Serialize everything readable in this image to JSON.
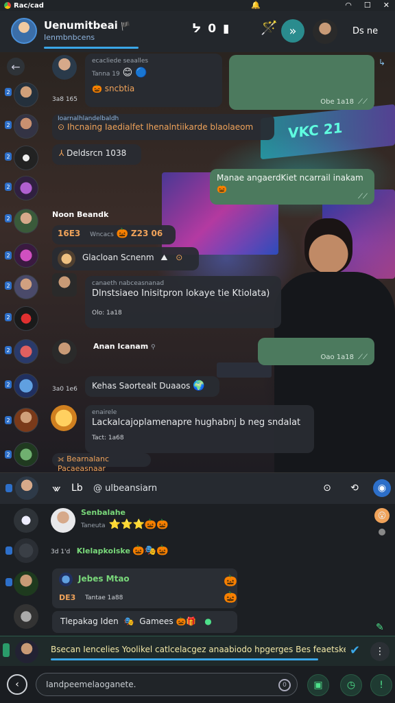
{
  "statusbar": {
    "app_name": "Rac/cad",
    "center_icon": "🔔",
    "wifi": "wifi-icon",
    "window": "☐",
    "close": "✕"
  },
  "header": {
    "title": "Uenumitbeai",
    "flag": "🏴",
    "subtitle": "Ienmbnbcens",
    "icons": [
      "ᔭ",
      "0",
      "▮"
    ],
    "done_label": "Ds ne"
  },
  "chat": {
    "neon_text": "VKC 21",
    "rail": {
      "badges": [
        "2",
        "2",
        "2",
        "2",
        "2",
        "2",
        "2",
        "2",
        "2",
        "2",
        "2",
        "2"
      ]
    },
    "messages": [
      {
        "id": "m1",
        "tiny": "ecacliede seaalles",
        "time_line": "Tanna 19",
        "sub": "sncbtia",
        "emojis": [
          "😊",
          "🔵"
        ]
      },
      {
        "id": "m2",
        "text": "",
        "meta": "Obe 1a18"
      },
      {
        "id": "rail_time_1",
        "text": "3a8 165"
      },
      {
        "id": "m3",
        "name": "Ioarnalhlandelbaldh",
        "text": "Ihcnaing Iaedialfet Ihenalntiikarde blaolaeom"
      },
      {
        "id": "m4",
        "text": "Deldsrcn 1038"
      },
      {
        "id": "m5",
        "text": "Manae angaerdKiet ncarrail inakam",
        "meta": ""
      },
      {
        "id": "m6",
        "name": "Noon Beandk",
        "tag": "16E3",
        "text": "Wncacs",
        "tag2": "Z23 06"
      },
      {
        "id": "m7",
        "text": "Glacloan Scnenm"
      },
      {
        "id": "m8",
        "tiny": "canaeth nabceasnanad",
        "text": "Dlnstsiaeo Inisitpron lokaye tie Ktiolata)",
        "sub": "Olo: 1a18"
      },
      {
        "id": "m9",
        "name": "Anan Icanam",
        "meta": "Oao 1a18"
      },
      {
        "id": "rail_time_2",
        "text": "3a0 1e6"
      },
      {
        "id": "m10",
        "text": "Kehas Saortealt Duaaos"
      },
      {
        "id": "m11",
        "tiny": "enairele",
        "text": "Lackalcajoplamenapre hughabnj b neg sndalat",
        "sub": "Tact: 1a68"
      },
      {
        "id": "m12",
        "text": "Bearnalanc Pacaeasnaar"
      }
    ]
  },
  "search": {
    "cmd_symbol": "⩖",
    "cmd_label": "Lb",
    "query": "@ ulbeansiarn"
  },
  "lower": {
    "items": [
      {
        "name": "Senbalahe",
        "sub": "Taneuta",
        "emojis": [
          "⭐",
          "⭐",
          "⭐",
          "🎃",
          "🎃"
        ]
      },
      {
        "time": "3d 1'd",
        "name": "Klelapkoiske",
        "emojis": [
          "🎃",
          "🎭",
          "🎃"
        ]
      },
      {
        "name": "Jebes Mtao",
        "tag": "DE3",
        "sub": "Tantae 1a88"
      },
      {
        "text": "Tlepakag Iden",
        "text2": "Gamees"
      }
    ]
  },
  "nowplaying": {
    "text": "Bsecan Iencelies Yoolikel catlcelacgez anaabiodo hpgerges Bes feaetskealt6ev"
  },
  "composer": {
    "placeholder": "Iandpeemelaoganete."
  },
  "colors": {
    "accent": "#3aa7e8",
    "outgoing": "#4c7a5e",
    "incoming": "#282c32"
  }
}
